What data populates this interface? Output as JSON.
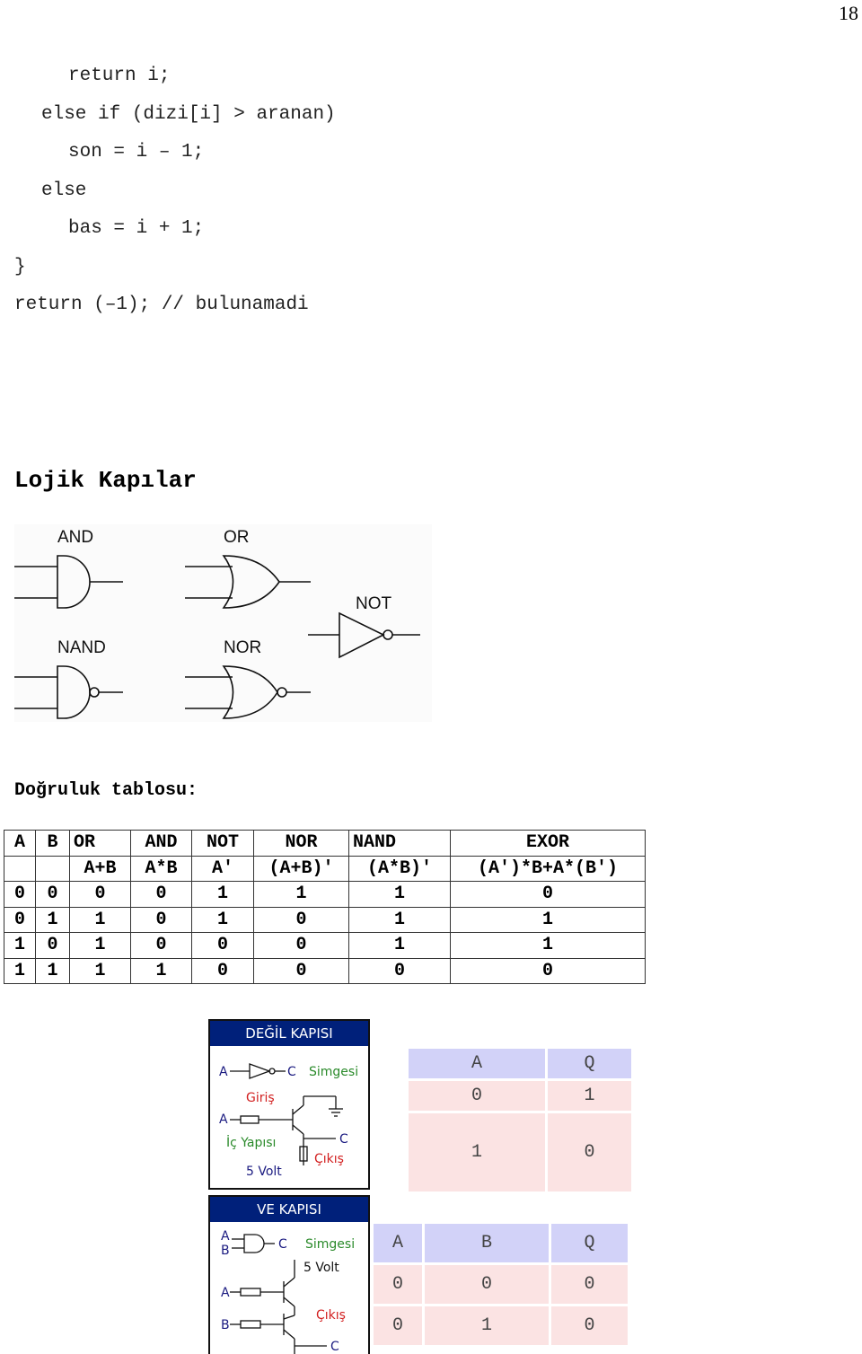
{
  "page_number": "18",
  "code_lines": [
    {
      "indent": 2,
      "text": "return i;"
    },
    {
      "indent": 1,
      "text": "else if (dizi[i] > aranan)"
    },
    {
      "indent": 2,
      "text": "son = i – 1;"
    },
    {
      "indent": 1,
      "text": "else"
    },
    {
      "indent": 2,
      "text": "bas = i + 1;"
    },
    {
      "indent": 0,
      "text": "}"
    },
    {
      "indent": 0,
      "text": "return (–1); // bulunamadi"
    }
  ],
  "section_title": "Lojik Kapılar",
  "gate_diagram": {
    "labels": {
      "and": "AND",
      "or": "OR",
      "not": "NOT",
      "nand": "NAND",
      "nor": "NOR"
    }
  },
  "truth_table_title": "Doğruluk tablosu:",
  "truth_table": {
    "headers": [
      "A",
      "B",
      "OR",
      "AND",
      "NOT",
      "NOR",
      "NAND",
      "EXOR"
    ],
    "expressions": [
      "",
      "",
      "A+B",
      "A*B",
      "A′",
      "(A+B)′",
      "(A*B)′",
      "(A′)*B+A*(B′)"
    ],
    "rows": [
      [
        "0",
        "0",
        "0",
        "0",
        "1",
        "1",
        "1",
        "0"
      ],
      [
        "0",
        "1",
        "1",
        "0",
        "1",
        "0",
        "1",
        "1"
      ],
      [
        "1",
        "0",
        "1",
        "0",
        "0",
        "0",
        "1",
        "1"
      ],
      [
        "1",
        "1",
        "1",
        "1",
        "0",
        "0",
        "0",
        "0"
      ]
    ]
  },
  "not_gate_panel": {
    "title": "DEĞİL KAPISI",
    "input_label": "A",
    "output_label": "C",
    "symbol_label": "Simgesi",
    "input_caption": "Giriş",
    "structure_caption": "İç Yapısı",
    "voltage": "5 Volt",
    "output_caption": "Çıkış"
  },
  "and_gate_panel": {
    "title": "VE KAPISI",
    "input_a": "A",
    "input_b": "B",
    "output_label": "C",
    "symbol_label": "Simgesi",
    "voltage": "5 Volt",
    "output_caption": "Çıkış"
  },
  "not_table": {
    "headers": [
      "A",
      "Q"
    ],
    "rows": [
      [
        "0",
        "1"
      ],
      [
        "1",
        "0"
      ]
    ]
  },
  "and_table": {
    "headers": [
      "A",
      "B",
      "Q"
    ],
    "rows": [
      [
        "0",
        "0",
        "0"
      ],
      [
        "0",
        "1",
        "0"
      ]
    ]
  },
  "colors": {
    "panel_title_bg": "#00207a",
    "table_header_bg": "#d2d2f8",
    "table_row_bg": "#fbe3e3",
    "caption_red": "#d22020",
    "caption_green": "#2a8a2a",
    "label_blue": "#1a1a80"
  }
}
